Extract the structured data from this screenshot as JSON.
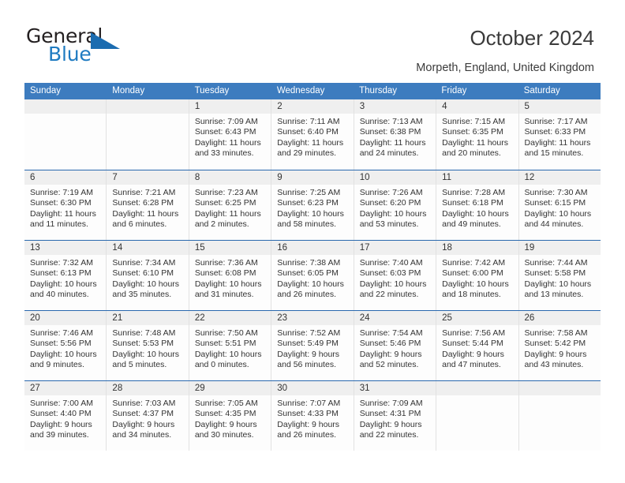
{
  "brand": {
    "name_part1": "General",
    "name_part2": "Blue",
    "logo_icon": "triangle-logo-icon",
    "accent_color": "#1b6cb0"
  },
  "header": {
    "title": "October 2024",
    "subtitle": "Morpeth, England, United Kingdom"
  },
  "calendar": {
    "header_bg_color": "#3d7cbf",
    "weekdays": [
      "Sunday",
      "Monday",
      "Tuesday",
      "Wednesday",
      "Thursday",
      "Friday",
      "Saturday"
    ],
    "weeks": [
      [
        {
          "day": "",
          "lines": []
        },
        {
          "day": "",
          "lines": []
        },
        {
          "day": "1",
          "lines": [
            "Sunrise: 7:09 AM",
            "Sunset: 6:43 PM",
            "Daylight: 11 hours",
            "and 33 minutes."
          ]
        },
        {
          "day": "2",
          "lines": [
            "Sunrise: 7:11 AM",
            "Sunset: 6:40 PM",
            "Daylight: 11 hours",
            "and 29 minutes."
          ]
        },
        {
          "day": "3",
          "lines": [
            "Sunrise: 7:13 AM",
            "Sunset: 6:38 PM",
            "Daylight: 11 hours",
            "and 24 minutes."
          ]
        },
        {
          "day": "4",
          "lines": [
            "Sunrise: 7:15 AM",
            "Sunset: 6:35 PM",
            "Daylight: 11 hours",
            "and 20 minutes."
          ]
        },
        {
          "day": "5",
          "lines": [
            "Sunrise: 7:17 AM",
            "Sunset: 6:33 PM",
            "Daylight: 11 hours",
            "and 15 minutes."
          ]
        }
      ],
      [
        {
          "day": "6",
          "lines": [
            "Sunrise: 7:19 AM",
            "Sunset: 6:30 PM",
            "Daylight: 11 hours",
            "and 11 minutes."
          ]
        },
        {
          "day": "7",
          "lines": [
            "Sunrise: 7:21 AM",
            "Sunset: 6:28 PM",
            "Daylight: 11 hours",
            "and 6 minutes."
          ]
        },
        {
          "day": "8",
          "lines": [
            "Sunrise: 7:23 AM",
            "Sunset: 6:25 PM",
            "Daylight: 11 hours",
            "and 2 minutes."
          ]
        },
        {
          "day": "9",
          "lines": [
            "Sunrise: 7:25 AM",
            "Sunset: 6:23 PM",
            "Daylight: 10 hours",
            "and 58 minutes."
          ]
        },
        {
          "day": "10",
          "lines": [
            "Sunrise: 7:26 AM",
            "Sunset: 6:20 PM",
            "Daylight: 10 hours",
            "and 53 minutes."
          ]
        },
        {
          "day": "11",
          "lines": [
            "Sunrise: 7:28 AM",
            "Sunset: 6:18 PM",
            "Daylight: 10 hours",
            "and 49 minutes."
          ]
        },
        {
          "day": "12",
          "lines": [
            "Sunrise: 7:30 AM",
            "Sunset: 6:15 PM",
            "Daylight: 10 hours",
            "and 44 minutes."
          ]
        }
      ],
      [
        {
          "day": "13",
          "lines": [
            "Sunrise: 7:32 AM",
            "Sunset: 6:13 PM",
            "Daylight: 10 hours",
            "and 40 minutes."
          ]
        },
        {
          "day": "14",
          "lines": [
            "Sunrise: 7:34 AM",
            "Sunset: 6:10 PM",
            "Daylight: 10 hours",
            "and 35 minutes."
          ]
        },
        {
          "day": "15",
          "lines": [
            "Sunrise: 7:36 AM",
            "Sunset: 6:08 PM",
            "Daylight: 10 hours",
            "and 31 minutes."
          ]
        },
        {
          "day": "16",
          "lines": [
            "Sunrise: 7:38 AM",
            "Sunset: 6:05 PM",
            "Daylight: 10 hours",
            "and 26 minutes."
          ]
        },
        {
          "day": "17",
          "lines": [
            "Sunrise: 7:40 AM",
            "Sunset: 6:03 PM",
            "Daylight: 10 hours",
            "and 22 minutes."
          ]
        },
        {
          "day": "18",
          "lines": [
            "Sunrise: 7:42 AM",
            "Sunset: 6:00 PM",
            "Daylight: 10 hours",
            "and 18 minutes."
          ]
        },
        {
          "day": "19",
          "lines": [
            "Sunrise: 7:44 AM",
            "Sunset: 5:58 PM",
            "Daylight: 10 hours",
            "and 13 minutes."
          ]
        }
      ],
      [
        {
          "day": "20",
          "lines": [
            "Sunrise: 7:46 AM",
            "Sunset: 5:56 PM",
            "Daylight: 10 hours",
            "and 9 minutes."
          ]
        },
        {
          "day": "21",
          "lines": [
            "Sunrise: 7:48 AM",
            "Sunset: 5:53 PM",
            "Daylight: 10 hours",
            "and 5 minutes."
          ]
        },
        {
          "day": "22",
          "lines": [
            "Sunrise: 7:50 AM",
            "Sunset: 5:51 PM",
            "Daylight: 10 hours",
            "and 0 minutes."
          ]
        },
        {
          "day": "23",
          "lines": [
            "Sunrise: 7:52 AM",
            "Sunset: 5:49 PM",
            "Daylight: 9 hours",
            "and 56 minutes."
          ]
        },
        {
          "day": "24",
          "lines": [
            "Sunrise: 7:54 AM",
            "Sunset: 5:46 PM",
            "Daylight: 9 hours",
            "and 52 minutes."
          ]
        },
        {
          "day": "25",
          "lines": [
            "Sunrise: 7:56 AM",
            "Sunset: 5:44 PM",
            "Daylight: 9 hours",
            "and 47 minutes."
          ]
        },
        {
          "day": "26",
          "lines": [
            "Sunrise: 7:58 AM",
            "Sunset: 5:42 PM",
            "Daylight: 9 hours",
            "and 43 minutes."
          ]
        }
      ],
      [
        {
          "day": "27",
          "lines": [
            "Sunrise: 7:00 AM",
            "Sunset: 4:40 PM",
            "Daylight: 9 hours",
            "and 39 minutes."
          ]
        },
        {
          "day": "28",
          "lines": [
            "Sunrise: 7:03 AM",
            "Sunset: 4:37 PM",
            "Daylight: 9 hours",
            "and 34 minutes."
          ]
        },
        {
          "day": "29",
          "lines": [
            "Sunrise: 7:05 AM",
            "Sunset: 4:35 PM",
            "Daylight: 9 hours",
            "and 30 minutes."
          ]
        },
        {
          "day": "30",
          "lines": [
            "Sunrise: 7:07 AM",
            "Sunset: 4:33 PM",
            "Daylight: 9 hours",
            "and 26 minutes."
          ]
        },
        {
          "day": "31",
          "lines": [
            "Sunrise: 7:09 AM",
            "Sunset: 4:31 PM",
            "Daylight: 9 hours",
            "and 22 minutes."
          ]
        },
        {
          "day": "",
          "lines": []
        },
        {
          "day": "",
          "lines": []
        }
      ]
    ]
  }
}
